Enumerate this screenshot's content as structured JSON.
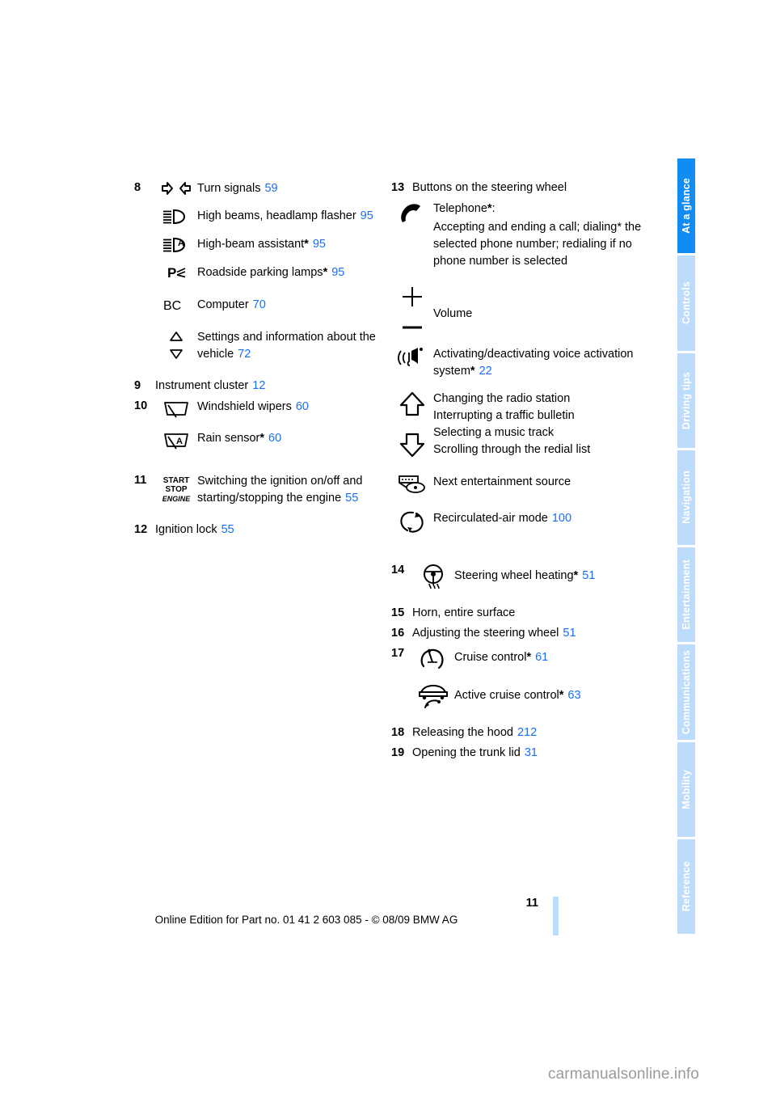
{
  "document": {
    "page_number": "11",
    "edition_line": "Online Edition for Part no. 01 41 2 603 085 - © 08/09 BMW AG",
    "watermark": "carmanualsonline.info",
    "accent_blue": "#1a6ef5",
    "tab_active_color": "#128cf5",
    "tab_inactive_color": "#bddbfa"
  },
  "tabs": [
    {
      "label": "At a glance",
      "active": true
    },
    {
      "label": "Controls",
      "active": false
    },
    {
      "label": "Driving tips",
      "active": false
    },
    {
      "label": "Navigation",
      "active": false
    },
    {
      "label": "Entertainment",
      "active": false
    },
    {
      "label": "Communications",
      "active": false
    },
    {
      "label": "Mobility",
      "active": false
    },
    {
      "label": "Reference",
      "active": false
    }
  ],
  "left_column": {
    "item8": {
      "number": "8",
      "rows": [
        {
          "icon": "turn-signals-icon",
          "text": "Turn signals",
          "page": "59",
          "star": false
        },
        {
          "icon": "high-beams-icon",
          "text": "High beams, headlamp flasher",
          "page": "95",
          "star": false
        },
        {
          "icon": "high-beam-assistant-icon",
          "text": "High-beam assistant",
          "page": "95",
          "star": true
        },
        {
          "icon": "roadside-parking-lamps-icon",
          "text": "Roadside parking lamps",
          "page": "95",
          "star": true
        },
        {
          "icon": "bc-computer-icon",
          "text": "Computer",
          "page": "70",
          "star": false
        },
        {
          "icon": "up-down-arrows-icon",
          "text": "Settings and information about the vehicle",
          "page": "72",
          "star": false
        }
      ]
    },
    "item9": {
      "number": "9",
      "text": "Instrument cluster",
      "page": "12"
    },
    "item10": {
      "number": "10",
      "rows": [
        {
          "icon": "windshield-wipers-icon",
          "text": "Windshield wipers",
          "page": "60",
          "star": false
        },
        {
          "icon": "rain-sensor-icon",
          "text": "Rain sensor",
          "page": "60",
          "star": true
        }
      ]
    },
    "item11": {
      "number": "11",
      "icon": "start-stop-engine-icon",
      "text": "Switching the ignition on/off and starting/stopping the engine",
      "page": "55"
    },
    "item12": {
      "number": "12",
      "text": "Ignition lock",
      "page": "55"
    }
  },
  "right_column": {
    "item13": {
      "number": "13",
      "heading": "Buttons on the steering wheel",
      "rows": [
        {
          "icon": "telephone-handset-icon",
          "title": "Telephone",
          "title_star": true,
          "title_suffix": ":",
          "body": "Accepting and ending a call; dialing* the selected phone number; redialing if no phone number is selected"
        },
        {
          "icon": "volume-plus-minus-icon",
          "text": "Volume",
          "page": "",
          "star": false
        },
        {
          "icon": "voice-activation-icon",
          "text": "Activating/deactivating voice activation system",
          "page": "22",
          "star": true
        },
        {
          "icon": "up-down-arrow-buttons-icon",
          "lines": [
            "Changing the radio station",
            "Interrupting a traffic bulletin",
            "Selecting a music track",
            "Scrolling through the redial list"
          ]
        },
        {
          "icon": "entertainment-source-icon",
          "text": "Next entertainment source",
          "page": "",
          "star": false
        },
        {
          "icon": "recirculated-air-icon",
          "text": "Recirculated-air mode",
          "page": "100",
          "star": false
        }
      ]
    },
    "item14": {
      "number": "14",
      "icon": "steering-wheel-heating-icon",
      "text": "Steering wheel heating",
      "page": "51",
      "star": true
    },
    "item15": {
      "number": "15",
      "text": "Horn, entire surface",
      "page": ""
    },
    "item16": {
      "number": "16",
      "text": "Adjusting the steering wheel",
      "page": "51"
    },
    "item17": {
      "number": "17",
      "rows": [
        {
          "icon": "cruise-control-icon",
          "text": "Cruise control",
          "page": "61",
          "star": true
        },
        {
          "icon": "active-cruise-control-icon",
          "text": "Active cruise control",
          "page": "63",
          "star": true
        }
      ]
    },
    "item18": {
      "number": "18",
      "text": "Releasing the hood",
      "page": "212"
    },
    "item19": {
      "number": "19",
      "text": "Opening the trunk lid",
      "page": "31"
    }
  }
}
